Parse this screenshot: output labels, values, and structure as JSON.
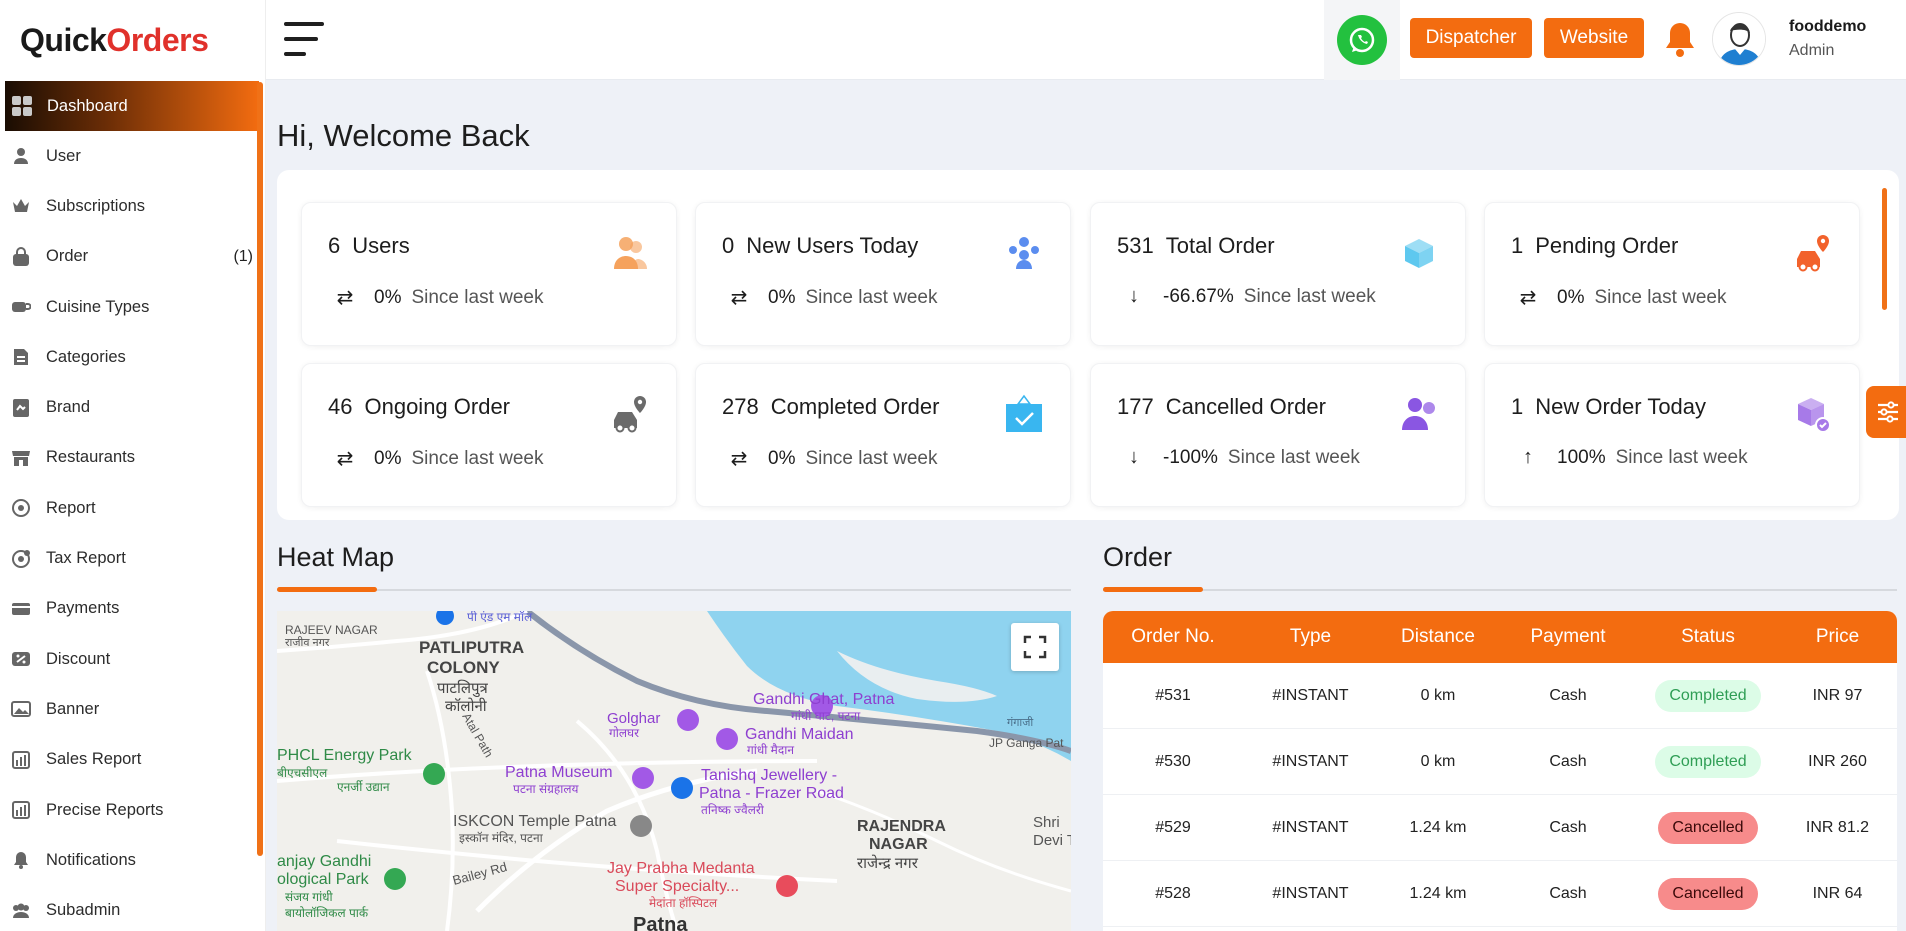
{
  "brand": {
    "part1": "Quick",
    "part2": "Orders"
  },
  "sidebar": {
    "items": [
      {
        "label": "Dashboard",
        "icon": "dashboard-icon",
        "active": true
      },
      {
        "label": "User",
        "icon": "user-icon"
      },
      {
        "label": "Subscriptions",
        "icon": "crown-icon"
      },
      {
        "label": "Order",
        "icon": "bag-icon",
        "count": "(1)"
      },
      {
        "label": "Cuisine Types",
        "icon": "cup-icon"
      },
      {
        "label": "Categories",
        "icon": "categories-icon"
      },
      {
        "label": "Brand",
        "icon": "brand-icon"
      },
      {
        "label": "Restaurants",
        "icon": "store-icon"
      },
      {
        "label": "Report",
        "icon": "report-icon"
      },
      {
        "label": "Tax Report",
        "icon": "tax-report-icon"
      },
      {
        "label": "Payments",
        "icon": "payments-icon"
      },
      {
        "label": "Discount",
        "icon": "discount-icon"
      },
      {
        "label": "Banner",
        "icon": "image-icon"
      },
      {
        "label": "Sales Report",
        "icon": "sales-report-icon"
      },
      {
        "label": "Precise Reports",
        "icon": "precise-reports-icon"
      },
      {
        "label": "Notifications",
        "icon": "bell-icon"
      },
      {
        "label": "Subadmin",
        "icon": "users-group-icon"
      }
    ]
  },
  "header": {
    "dispatcher_label": "Dispatcher",
    "website_label": "Website",
    "user_name": "fooddemo",
    "user_role": "Admin"
  },
  "welcome": "Hi, Welcome Back",
  "stats": [
    {
      "value": "6",
      "label": "Users",
      "trend": "⇄",
      "pct": "0%",
      "since": "Since last week",
      "icon": "users-icon",
      "color": "#f5a25d"
    },
    {
      "value": "0",
      "label": "New Users Today",
      "trend": "⇄",
      "pct": "0%",
      "since": "Since last week",
      "icon": "people-group-icon",
      "color": "#5b8def"
    },
    {
      "value": "531",
      "label": "Total Order",
      "trend": "↓",
      "pct": "-66.67%",
      "since": "Since last week",
      "icon": "box-icon",
      "color": "#5ec8ef"
    },
    {
      "value": "1",
      "label": "Pending Order",
      "trend": "⇄",
      "pct": "0%",
      "since": "Since last week",
      "icon": "car-pin-icon",
      "color": "#f2622c"
    },
    {
      "value": "46",
      "label": "Ongoing Order",
      "trend": "⇄",
      "pct": "0%",
      "since": "Since last week",
      "icon": "car-pin-icon",
      "color": "#6b6b6b"
    },
    {
      "value": "278",
      "label": "Completed Order",
      "trend": "⇄",
      "pct": "0%",
      "since": "Since last week",
      "icon": "check-box-icon",
      "color": "#39b6f0"
    },
    {
      "value": "177",
      "label": "Cancelled Order",
      "trend": "↓",
      "pct": "-100%",
      "since": "Since last week",
      "icon": "user-cancel-icon",
      "color": "#8a56e2"
    },
    {
      "value": "1",
      "label": "New Order Today",
      "trend": "↑",
      "pct": "100%",
      "since": "Since last week",
      "icon": "box-check-icon",
      "color": "#a77ae8"
    }
  ],
  "heatmap": {
    "title": "Heat Map",
    "labels": [
      {
        "text": "पी एंड एम मॉल",
        "color": "#5a5fd6"
      },
      {
        "text": "RAJEEV NAGAR",
        "color": "#555"
      },
      {
        "text": "राजीव नगर",
        "color": "#555"
      },
      {
        "text": "PATLIPUTRA",
        "color": "#444"
      },
      {
        "text": "COLONY",
        "color": "#444"
      },
      {
        "text": "पाटलिपुत्र",
        "color": "#444"
      },
      {
        "text": "कॉलोनी",
        "color": "#444"
      },
      {
        "text": "Golghar",
        "color": "#8e3fd0"
      },
      {
        "text": "गोलघर",
        "color": "#8e3fd0"
      },
      {
        "text": "Gandhi Ghat, Patna",
        "color": "#8e3fd0"
      },
      {
        "text": "गांधी घाट, पटना",
        "color": "#8e3fd0"
      },
      {
        "text": "Gandhi Maidan",
        "color": "#8e3fd0"
      },
      {
        "text": "गांधी मैदान",
        "color": "#8e3fd0"
      },
      {
        "text": "गंगाजी",
        "color": "#4a6f8a"
      },
      {
        "text": "JP Ganga Pat",
        "color": "#555"
      },
      {
        "text": "Atal Path",
        "color": "#555"
      },
      {
        "text": "PHCL Energy Park",
        "color": "#2f8a47"
      },
      {
        "text": "बीएचसीएल",
        "color": "#2f8a47"
      },
      {
        "text": "एनर्जी उद्यान",
        "color": "#2f8a47"
      },
      {
        "text": "Patna Museum",
        "color": "#8e3fd0"
      },
      {
        "text": "पटना संग्रहालय",
        "color": "#8e3fd0"
      },
      {
        "text": "Tanishq Jewellery -",
        "color": "#8e3fd0"
      },
      {
        "text": "Patna - Frazer Road",
        "color": "#8e3fd0"
      },
      {
        "text": "तनिष्क ज्वैलरी",
        "color": "#8e3fd0"
      },
      {
        "text": "ISKCON Temple Patna",
        "color": "#555"
      },
      {
        "text": "इस्कॉन मंदिर, पटना",
        "color": "#555"
      },
      {
        "text": "RAJENDRA",
        "color": "#444"
      },
      {
        "text": "NAGAR",
        "color": "#444"
      },
      {
        "text": "राजेन्द्र नगर",
        "color": "#444"
      },
      {
        "text": "Shri",
        "color": "#555"
      },
      {
        "text": "Devi Ten",
        "color": "#555"
      },
      {
        "text": "anjay Gandhi",
        "color": "#2f8a47"
      },
      {
        "text": "ological Park",
        "color": "#2f8a47"
      },
      {
        "text": "संजय गांधी",
        "color": "#2f8a47"
      },
      {
        "text": "बायोलॉजिकल पार्क",
        "color": "#2f8a47"
      },
      {
        "text": "Bailey Rd",
        "color": "#555"
      },
      {
        "text": "Jay Prabha Medanta",
        "color": "#d94a5a"
      },
      {
        "text": "Super Specialty...",
        "color": "#d94a5a"
      },
      {
        "text": "मेदांता हॉस्पिटल",
        "color": "#d94a5a"
      },
      {
        "text": "Patna",
        "color": "#333"
      }
    ]
  },
  "orders": {
    "title": "Order",
    "columns": [
      "Order No.",
      "Type",
      "Distance",
      "Payment",
      "Status",
      "Price"
    ],
    "rows": [
      {
        "no": "#531",
        "type": "#INSTANT",
        "distance": "0 km",
        "payment": "Cash",
        "status": "Completed",
        "price": "INR 97"
      },
      {
        "no": "#530",
        "type": "#INSTANT",
        "distance": "0 km",
        "payment": "Cash",
        "status": "Completed",
        "price": "INR 260"
      },
      {
        "no": "#529",
        "type": "#INSTANT",
        "distance": "1.24 km",
        "payment": "Cash",
        "status": "Cancelled",
        "price": "INR 81.2"
      },
      {
        "no": "#528",
        "type": "#INSTANT",
        "distance": "1.24 km",
        "payment": "Cash",
        "status": "Cancelled",
        "price": "INR 64"
      }
    ]
  },
  "colors": {
    "accent": "#f36c10",
    "whatsapp": "#23c13f",
    "completed_bg": "#dcfce7",
    "cancelled_bg": "#f78b8b"
  }
}
